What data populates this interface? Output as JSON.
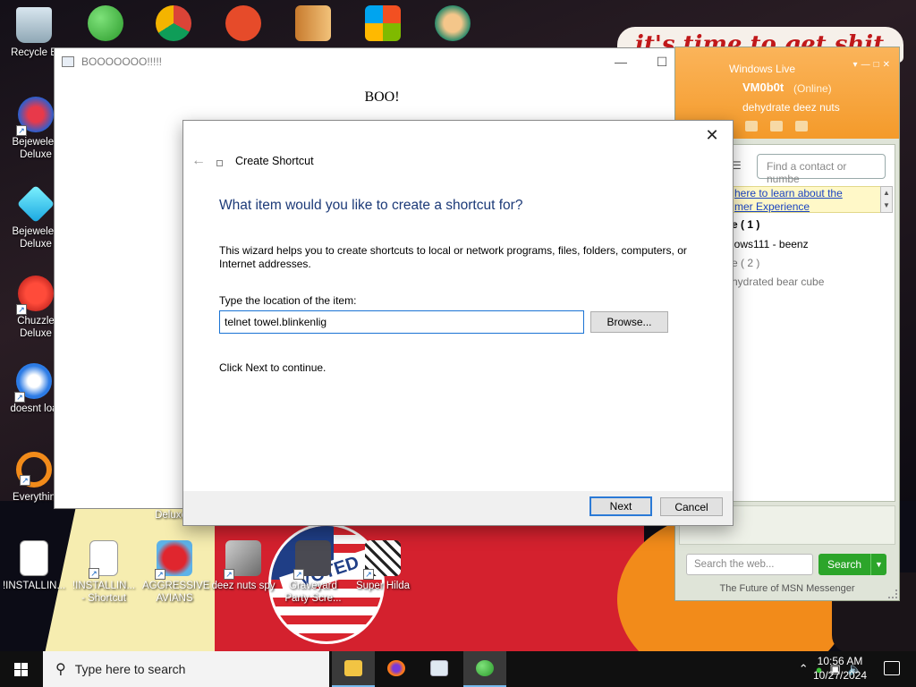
{
  "desktop": {
    "icons": [
      {
        "label": "Recycle B"
      },
      {
        "label": "Bejeweled Deluxe"
      },
      {
        "label": "Bejeweled Deluxe"
      },
      {
        "label": "Chuzzle Deluxe"
      },
      {
        "label": "doesnt loa"
      },
      {
        "label": "Everythin"
      },
      {
        "label": "!INSTALLIN..."
      },
      {
        "label": "!INSTALLIN... - Shortcut"
      },
      {
        "label": "AGGRESSIVE AVIANS"
      },
      {
        "label": "deez nuts spy"
      },
      {
        "label": "Graveyard Party Scre..."
      },
      {
        "label": "Super Hilda"
      },
      {
        "label": "Deluxe"
      }
    ],
    "wallpaper_banner": "it's time to get shit",
    "wallpaper_vote": "VOTED"
  },
  "boo_window": {
    "title": "BOOOOOOO!!!!!",
    "body_text": "BOO!"
  },
  "msn": {
    "brand": "Windows Live",
    "display_name": "VM0b0t",
    "status": "(Online)",
    "personal_message": "dehydrate deez nuts",
    "search_placeholder": "Find a contact or numbe",
    "info_line1": "here to learn about the",
    "info_line2": "mer Experience",
    "group_online": "e ( 1 )",
    "contact_online": "lows111 - beenz",
    "group_offline": "e ( 2 )",
    "contact_offline": "hydrated bear cube",
    "web_search_placeholder": "Search the web...",
    "web_search_button": "Search",
    "tagline": "The Future of MSN Messenger"
  },
  "shortcut_dialog": {
    "title": "Create Shortcut",
    "heading": "What item would you like to create a shortcut for?",
    "description": "This wizard helps you to create shortcuts to local or network programs, files, folders, computers, or Internet addresses.",
    "location_label": "Type the location of the item:",
    "location_value": "telnet towel.blinkenlig",
    "browse_label": "Browse...",
    "hint": "Click Next to continue.",
    "next_label": "Next",
    "cancel_label": "Cancel"
  },
  "taskbar": {
    "search_placeholder": "Type here to search",
    "time": "10:56 AM",
    "date": "10/27/2024"
  },
  "colors": {
    "dialog_heading": "#1c3a78",
    "msn_orange": "#f49a2a",
    "msn_green": "#2ca52a",
    "focus_blue": "#2b7ad6"
  }
}
